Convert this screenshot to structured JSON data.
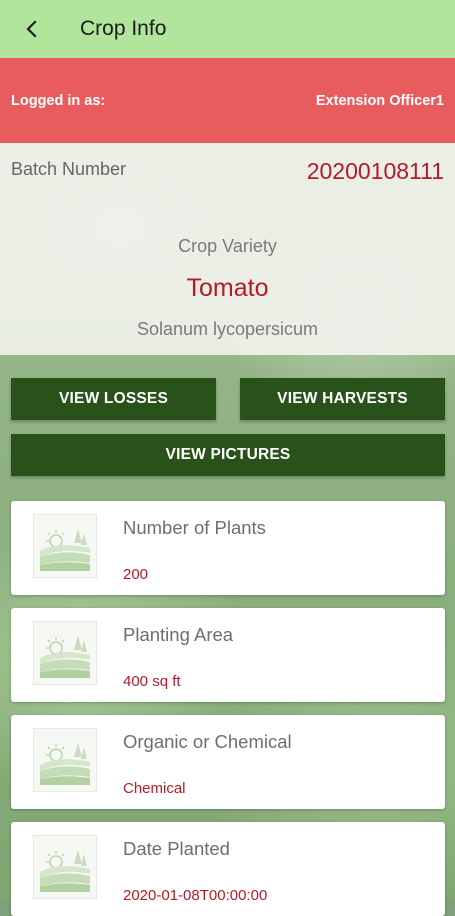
{
  "appbar": {
    "title": "Crop Info",
    "back_icon": "chevron-left-icon"
  },
  "login": {
    "label": "Logged in as:",
    "user": "Extension Officer1"
  },
  "crop": {
    "batch_label": "Batch Number",
    "batch_number": "20200108111",
    "variety_label": "Crop Variety",
    "variety_name": "Tomato",
    "scientific_name": "Solanum lycopersicum"
  },
  "buttons": {
    "losses": "VIEW LOSSES",
    "harvests": "VIEW HARVESTS",
    "pictures": "VIEW PICTURES"
  },
  "cards": [
    {
      "title": "Number of Plants",
      "value": "200",
      "icon": "farm-landscape-icon"
    },
    {
      "title": "Planting Area",
      "value": "400 sq ft",
      "icon": "farm-landscape-icon"
    },
    {
      "title": "Organic or Chemical",
      "value": "Chemical",
      "icon": "farm-landscape-icon"
    },
    {
      "title": "Date Planted",
      "value": "2020-01-08T00:00:00",
      "icon": "farm-landscape-icon"
    }
  ],
  "colors": {
    "appbar": "#b2e59c",
    "banner": "#e85c5e",
    "button": "#285219",
    "accent_text": "#b31b2b"
  }
}
